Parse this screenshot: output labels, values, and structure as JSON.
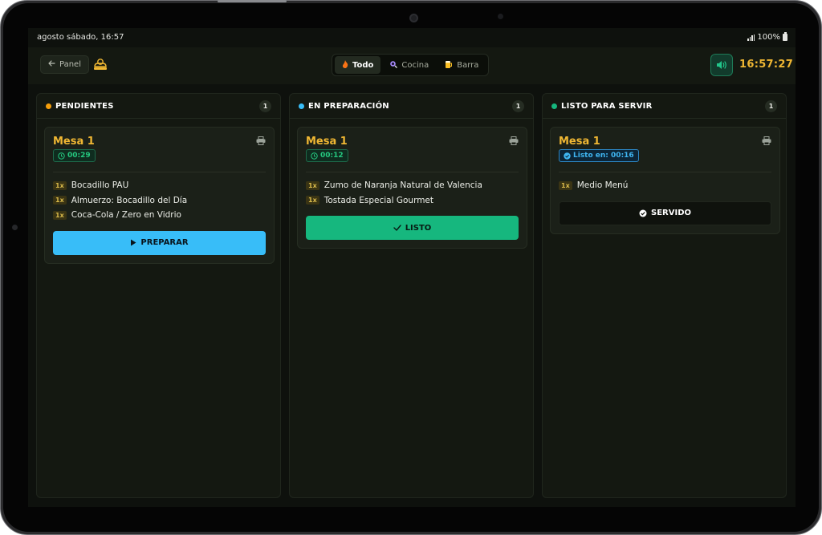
{
  "status_bar": {
    "datetime": "agosto sábado, 16:57",
    "battery": "100%"
  },
  "topbar": {
    "back_label": "Panel",
    "filters": [
      {
        "label": "Todo",
        "icon": "flame-icon",
        "active": true
      },
      {
        "label": "Cocina",
        "icon": "pot-icon",
        "active": false
      },
      {
        "label": "Barra",
        "icon": "beer-icon",
        "active": false
      }
    ],
    "clock": "16:57:27"
  },
  "colors": {
    "accent_gold": "#f0b733",
    "pending": "#f59e0b",
    "preparing": "#38bdf8",
    "ready": "#16b77e"
  },
  "columns": [
    {
      "title": "PENDIENTES",
      "count": "1",
      "card": {
        "table": "Mesa 1",
        "timer": "00:29",
        "items": [
          {
            "qty": "1x",
            "name": "Bocadillo PAU"
          },
          {
            "qty": "1x",
            "name": "Almuerzo: Bocadillo del Día"
          },
          {
            "qty": "1x",
            "name": "Coca-Cola / Zero en Vidrio"
          }
        ],
        "action": "PREPARAR"
      }
    },
    {
      "title": "EN PREPARACIÓN",
      "count": "1",
      "card": {
        "table": "Mesa 1",
        "timer": "00:12",
        "items": [
          {
            "qty": "1x",
            "name": "Zumo de Naranja Natural de Valencia"
          },
          {
            "qty": "1x",
            "name": "Tostada Especial Gourmet"
          }
        ],
        "action": "LISTO"
      }
    },
    {
      "title": "LISTO PARA SERVIR",
      "count": "1",
      "card": {
        "table": "Mesa 1",
        "timer": "Listo en: 00:16",
        "items": [
          {
            "qty": "1x",
            "name": "Medio Menú"
          }
        ],
        "action": "SERVIDO"
      }
    }
  ]
}
